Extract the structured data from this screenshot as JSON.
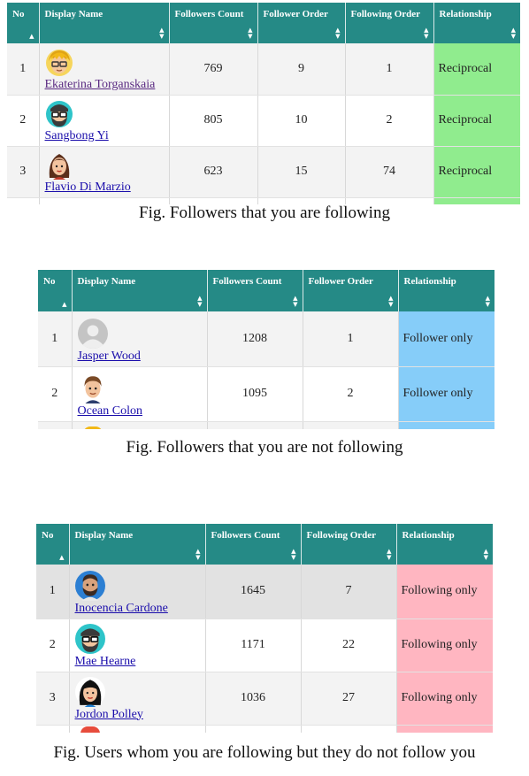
{
  "table1": {
    "headers": [
      "No",
      "Display Name",
      "Followers Count",
      "Follower Order",
      "Following Order",
      "Relationship"
    ],
    "rows": [
      {
        "no": "1",
        "name": "Ekaterina Torganskaia",
        "followers": "769",
        "follower_order": "9",
        "following_order": "1",
        "relationship": "Reciprocal",
        "avatar": "blonde-glasses-avatar-icon"
      },
      {
        "no": "2",
        "name": "Sangbong Yi",
        "followers": "805",
        "follower_order": "10",
        "following_order": "2",
        "relationship": "Reciprocal",
        "avatar": "bearded-glasses-avatar-icon"
      },
      {
        "no": "3",
        "name": "Flavio Di Marzio",
        "followers": "623",
        "follower_order": "15",
        "following_order": "74",
        "relationship": "Reciprocal",
        "avatar": "woman-avatar-icon"
      }
    ],
    "caption": "Fig. Followers that you are following",
    "relationship_color": "#90ec8e"
  },
  "table2": {
    "headers": [
      "No",
      "Display Name",
      "Followers Count",
      "Follower Order",
      "Relationship"
    ],
    "rows": [
      {
        "no": "1",
        "name": "Jasper Wood",
        "followers": "1208",
        "follower_order": "1",
        "relationship": "Follower only",
        "avatar": "default-user-avatar-icon"
      },
      {
        "no": "2",
        "name": "Ocean Colon",
        "followers": "1095",
        "follower_order": "2",
        "relationship": "Follower only",
        "avatar": "man-avatar-icon"
      }
    ],
    "caption": "Fig. Followers that you are not following",
    "relationship_color": "#86cdf9"
  },
  "table3": {
    "headers": [
      "No",
      "Display Name",
      "Followers Count",
      "Following Order",
      "Relationship"
    ],
    "rows": [
      {
        "no": "1",
        "name": "Inocencia Cardone",
        "followers": "1645",
        "following_order": "7",
        "relationship": "Following only",
        "avatar": "bearded-man-avatar-icon"
      },
      {
        "no": "2",
        "name": "Mae Hearne",
        "followers": "1171",
        "following_order": "22",
        "relationship": "Following only",
        "avatar": "bearded-glasses-avatar-icon"
      },
      {
        "no": "3",
        "name": "Jordon Polley",
        "followers": "1036",
        "following_order": "27",
        "relationship": "Following only",
        "avatar": "woman-dark-hair-avatar-icon"
      }
    ],
    "caption": "Fig. Users whom you are following but they do not follow you",
    "relationship_color": "#ffb6c1"
  },
  "colors": {
    "header_bg": "#258a86",
    "row_alt": "#f3f3f3",
    "link": "#1a0dab"
  }
}
